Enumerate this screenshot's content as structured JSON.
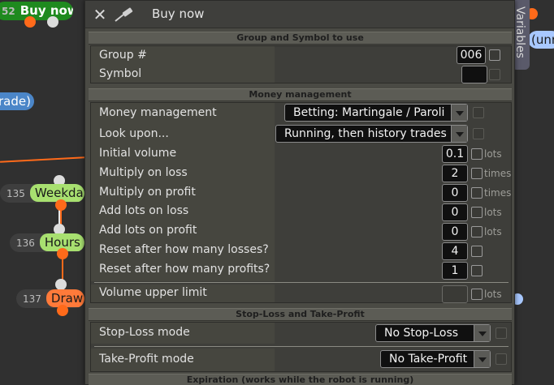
{
  "background": {
    "node_buy_now": {
      "num": "52",
      "label": "Buy now"
    },
    "node_trade": {
      "label": "rade)"
    },
    "node_weekday": {
      "num": "135",
      "label": "Weekday"
    },
    "node_hours": {
      "num": "136",
      "label": "Hours f"
    },
    "node_draw": {
      "num": "137",
      "label": "Draw L"
    },
    "node_unr": {
      "label": "(unr"
    },
    "variables_tab": "Variables"
  },
  "dialog": {
    "title": "Buy now",
    "sections": {
      "group": "Group and Symbol to use",
      "money": "Money management",
      "sltp": "Stop-Loss and Take-Profit",
      "expiration": "Expiration (works while the robot is running)"
    },
    "group": {
      "group_label": "Group #",
      "group_value": "006",
      "symbol_label": "Symbol",
      "symbol_value": ""
    },
    "money": {
      "mm_label": "Money management",
      "mm_value": "Betting: Martingale / Paroli",
      "look_label": "Look upon...",
      "look_value": "Running, then history trades",
      "initial_label": "Initial volume",
      "initial_value": "0.1",
      "initial_unit": "lots",
      "mloss_label": "Multiply on loss",
      "mloss_value": "2",
      "mloss_unit": "times",
      "mprofit_label": "Multiply on profit",
      "mprofit_value": "0",
      "mprofit_unit": "times",
      "addloss_label": "Add lots on loss",
      "addloss_value": "0",
      "addloss_unit": "lots",
      "addprofit_label": "Add lots on profit",
      "addprofit_value": "0",
      "addprofit_unit": "lots",
      "resetloss_label": "Reset after how many losses?",
      "resetloss_value": "4",
      "resetprofit_label": "Reset after how many profits?",
      "resetprofit_value": "1",
      "upper_label": "Volume upper limit",
      "upper_value": "",
      "upper_unit": "lots"
    },
    "sltp": {
      "sl_label": "Stop-Loss mode",
      "sl_value": "No Stop-Loss",
      "tp_label": "Take-Profit mode",
      "tp_value": "No Take-Profit"
    }
  }
}
